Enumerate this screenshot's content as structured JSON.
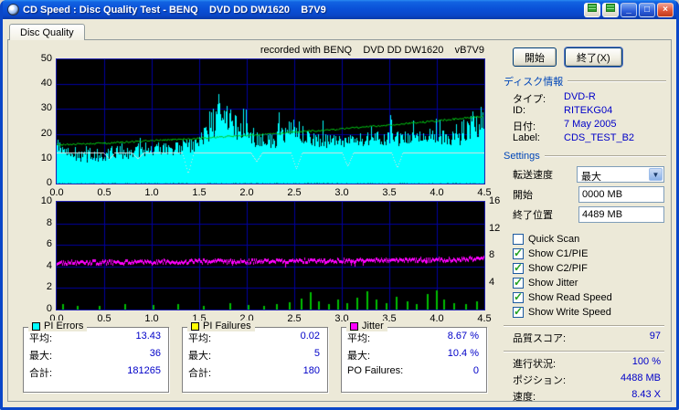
{
  "window": {
    "title": "CD Speed : Disc Quality Test - BENQ    DVD DD DW1620    B7V9",
    "controls": {
      "minimize": "_",
      "maximize": "□",
      "close": "×"
    }
  },
  "tab": {
    "label": "Disc Quality"
  },
  "buttons": {
    "start": "開始",
    "exit": "終了(X)"
  },
  "disc_info": {
    "header": "ディスク情報",
    "rows": [
      [
        "タイプ:",
        "DVD-R"
      ],
      [
        "ID:",
        "RITEKG04"
      ],
      [
        "日付:",
        "7 May 2005"
      ],
      [
        "Label:",
        "CDS_TEST_B2"
      ]
    ]
  },
  "settings": {
    "header": "Settings",
    "speed_label": "転送速度",
    "speed_value": "最大",
    "start_label": "開始",
    "start_value": "0000 MB",
    "end_label": "終了位置",
    "end_value": "4489 MB",
    "checkboxes": [
      {
        "label": "Quick Scan",
        "checked": false
      },
      {
        "label": "Show C1/PIE",
        "checked": true
      },
      {
        "label": "Show C2/PIF",
        "checked": true
      },
      {
        "label": "Show Jitter",
        "checked": true
      },
      {
        "label": "Show Read Speed",
        "checked": true
      },
      {
        "label": "Show Write Speed",
        "checked": true
      }
    ]
  },
  "status": {
    "score_label": "品質スコア:",
    "score_value": "97",
    "progress_label": "進行状況:",
    "progress_value": "100 %",
    "position_label": "ポジション:",
    "position_value": "4488 MB",
    "speed_label": "速度:",
    "speed_value": "8.43 X"
  },
  "stats": [
    {
      "legend_color": "#00FFFF",
      "title": "PI Errors",
      "rows": [
        [
          "平均:",
          "13.43"
        ],
        [
          "最大:",
          "36"
        ],
        [
          "合計:",
          "181265"
        ]
      ]
    },
    {
      "legend_color": "#FFFF00",
      "title": "PI Failures",
      "rows": [
        [
          "平均:",
          "0.02"
        ],
        [
          "最大:",
          "5"
        ],
        [
          "合計:",
          "180"
        ]
      ]
    },
    {
      "legend_color": "#FF00FF",
      "title": "Jitter",
      "rows": [
        [
          "平均:",
          "8.67 %"
        ],
        [
          "最大:",
          "10.4 %"
        ],
        [
          "PO Failures:",
          "0"
        ]
      ]
    }
  ],
  "chart_data": [
    {
      "type": "area",
      "title": "recorded with BENQ    DVD DD DW1620    vB7V9",
      "xlim": [
        0,
        4.5
      ],
      "ylim": [
        0,
        50
      ],
      "x_ticks": [
        "0.0",
        "0.5",
        "1.0",
        "1.5",
        "2.0",
        "2.5",
        "3.0",
        "3.5",
        "4.0",
        "4.5"
      ],
      "y_ticks": [
        50,
        40,
        30,
        20,
        10,
        0
      ],
      "grid": true,
      "bg": "#000000",
      "grid_color": "#0000A0",
      "series": [
        {
          "name": "PI Errors",
          "style": "spiky-area",
          "color": "#00FFFF",
          "x": [
            0,
            0.25,
            0.5,
            0.75,
            1,
            1.25,
            1.5,
            1.75,
            2,
            2.25,
            2.5,
            2.75,
            3,
            3.25,
            3.5,
            3.75,
            4,
            4.25,
            4.5
          ],
          "y": [
            12,
            8,
            9,
            10,
            11,
            11,
            13,
            19,
            15,
            14,
            16,
            14,
            14,
            15,
            15,
            15,
            16,
            15,
            19
          ],
          "noise": 6,
          "spike_zones": [
            [
              1.5,
              2.0,
              9
            ],
            [
              2.3,
              2.6,
              5
            ],
            [
              4.25,
              4.5,
              7
            ]
          ],
          "max_spike": {
            "x": 1.7,
            "y": 36
          }
        },
        {
          "name": "Read Speed",
          "style": "line",
          "color": "#00C814",
          "x": [
            0,
            0.5,
            1,
            1.5,
            2,
            2.5,
            3,
            3.5,
            4,
            4.5
          ],
          "y": [
            15.5,
            16.3,
            17.2,
            18.2,
            19.3,
            20.6,
            22,
            23.5,
            25.2,
            27.2
          ]
        },
        {
          "name": "Write Speed",
          "style": "line-dips",
          "color": "#E0E0E0",
          "level": 12.5,
          "dip_width": 0.06,
          "dips": [
            {
              "x": 0.55,
              "min": 10
            },
            {
              "x": 0.85,
              "min": 10
            },
            {
              "x": 1.38,
              "min": 4
            },
            {
              "x": 2.1,
              "min": 9
            },
            {
              "x": 2.52,
              "min": 6
            },
            {
              "x": 3.06,
              "min": 7
            },
            {
              "x": 3.58,
              "min": 6.5
            }
          ]
        }
      ]
    },
    {
      "type": "line",
      "xlim": [
        0,
        4.5
      ],
      "ylim": [
        0,
        10
      ],
      "right_ylim": [
        0,
        16
      ],
      "x_ticks": [
        "0.0",
        "0.5",
        "1.0",
        "1.5",
        "2.0",
        "2.5",
        "3.0",
        "3.5",
        "4.0",
        "4.5"
      ],
      "y_ticks_left": [
        10,
        8,
        6,
        4,
        2,
        0
      ],
      "y_ticks_right": [
        16,
        12,
        8,
        4
      ],
      "grid": true,
      "bg": "#000000",
      "grid_color": "#0000A0",
      "series": [
        {
          "name": "PI Failures",
          "style": "bars",
          "color": "#00BE00",
          "bars": [
            [
              0.07,
              0.5
            ],
            [
              0.22,
              0.35
            ],
            [
              0.45,
              0.3
            ],
            [
              0.72,
              0.55
            ],
            [
              1.02,
              0.4
            ],
            [
              1.28,
              0.5
            ],
            [
              1.55,
              0.35
            ],
            [
              1.83,
              0.6
            ],
            [
              2.02,
              0.45
            ],
            [
              2.18,
              0.35
            ],
            [
              2.32,
              0.5
            ],
            [
              2.45,
              0.7
            ],
            [
              2.58,
              1.0
            ],
            [
              2.67,
              1.6
            ],
            [
              2.76,
              0.8
            ],
            [
              2.87,
              0.5
            ],
            [
              2.96,
              0.9
            ],
            [
              3.06,
              0.6
            ],
            [
              3.16,
              1.1
            ],
            [
              3.27,
              1.7
            ],
            [
              3.37,
              0.9
            ],
            [
              3.47,
              0.6
            ],
            [
              3.58,
              1.2
            ],
            [
              3.69,
              0.8
            ],
            [
              3.79,
              0.5
            ],
            [
              3.9,
              1.4
            ],
            [
              4.0,
              1.8
            ],
            [
              4.08,
              0.9
            ],
            [
              4.18,
              0.6
            ],
            [
              4.31,
              0.5
            ],
            [
              4.42,
              0.8
            ]
          ]
        },
        {
          "name": "Jitter",
          "style": "fuzzy-line",
          "color": "#FF00FF",
          "x": [
            0,
            0.5,
            1,
            1.5,
            2,
            2.5,
            3,
            3.5,
            4,
            4.5
          ],
          "y": [
            4.35,
            4.4,
            4.45,
            4.5,
            4.5,
            4.55,
            4.55,
            4.6,
            4.65,
            4.75
          ],
          "noise": 0.18
        }
      ]
    }
  ]
}
